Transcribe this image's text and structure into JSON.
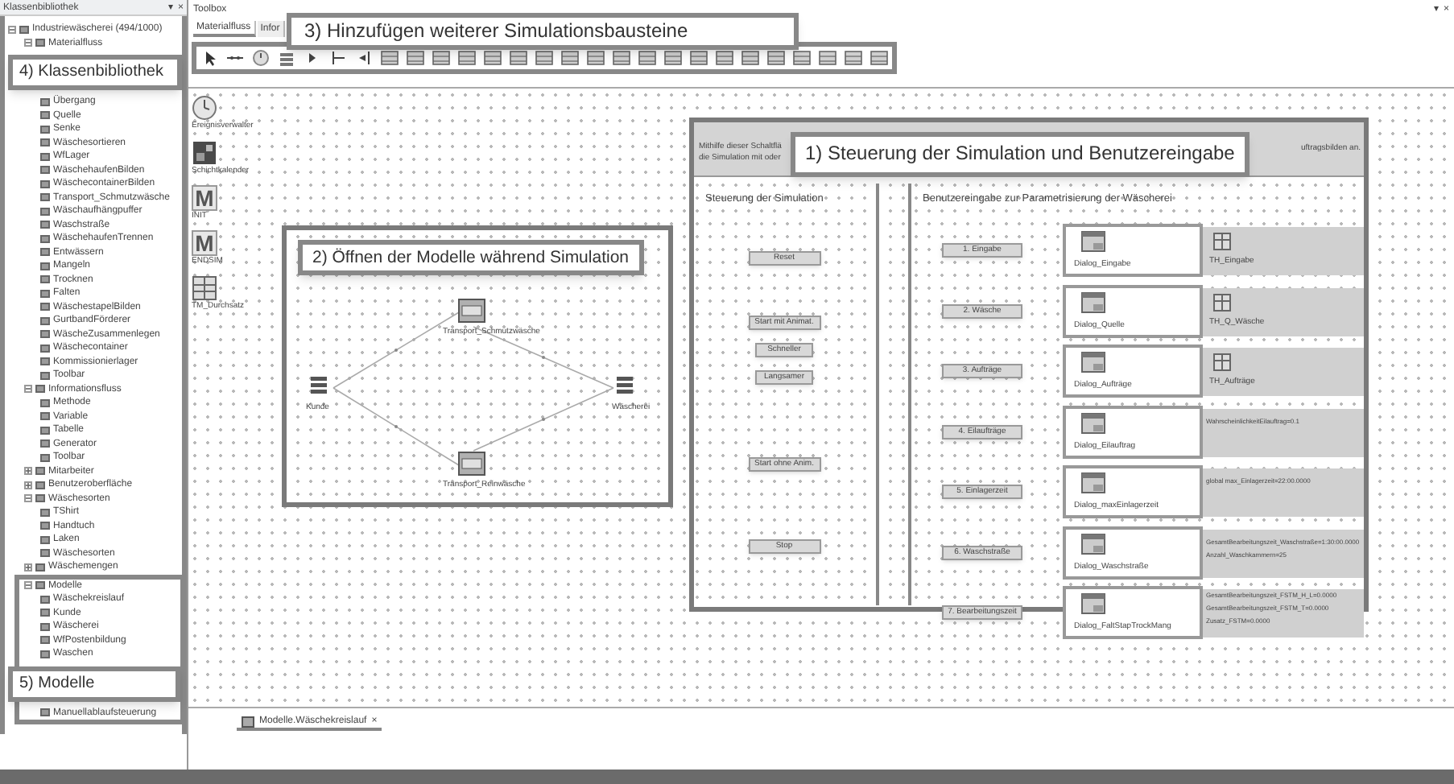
{
  "library": {
    "title": "Klassenbibliothek",
    "controls": [
      "▾",
      "×"
    ],
    "tree": [
      {
        "label": "Industriewäscherei (494/1000)",
        "expanded": true,
        "children": [
          {
            "label": "Materialfluss",
            "expanded": true,
            "children": [
              {
                "kind": "callout",
                "label": "4) Klassenbibliothek"
              },
              {
                "label": "Übergang"
              },
              {
                "label": "Quelle"
              },
              {
                "label": "Senke"
              },
              {
                "label": "Wäschesortieren"
              },
              {
                "label": "WfLager"
              },
              {
                "label": "WäschehaufenBilden"
              },
              {
                "label": "WäschecontainerBilden"
              },
              {
                "label": "Transport_Schmutzwäsche"
              },
              {
                "label": "Wäschaufhängpuffer"
              },
              {
                "label": "Waschstraße"
              },
              {
                "label": "WäschehaufenTrennen"
              },
              {
                "label": "Entwässern"
              },
              {
                "label": "Mangeln"
              },
              {
                "label": "Trocknen"
              },
              {
                "label": "Falten"
              },
              {
                "label": "WäschestapelBilden"
              },
              {
                "label": "GurtbandFörderer"
              },
              {
                "label": "WäscheZusammenlegen"
              },
              {
                "label": "Wäschecontainer"
              },
              {
                "label": "Kommissionierlager"
              },
              {
                "label": "Toolbar"
              }
            ]
          },
          {
            "label": "Informationsfluss",
            "expanded": true,
            "children": [
              {
                "label": "Methode"
              },
              {
                "label": "Variable"
              },
              {
                "label": "Tabelle"
              },
              {
                "label": "Generator"
              },
              {
                "label": "Toolbar"
              }
            ]
          },
          {
            "label": "Mitarbeiter",
            "expanded": false
          },
          {
            "label": "Benutzeroberfläche",
            "expanded": false
          },
          {
            "label": "Wäschesorten",
            "expanded": true,
            "children": [
              {
                "label": "TShirt"
              },
              {
                "label": "Handtuch"
              },
              {
                "label": "Laken"
              },
              {
                "label": "Wäschesorten"
              }
            ]
          },
          {
            "label": "Wäschemengen",
            "expanded": false
          },
          {
            "label": "Modelle",
            "expanded": true,
            "children": [
              {
                "label": "Wäschekreislauf"
              },
              {
                "label": "Kunde"
              },
              {
                "label": "Wäscherei"
              },
              {
                "label": "WfPostenbildung"
              },
              {
                "label": "Waschen"
              },
              {
                "kind": "callout",
                "label": "5) Modelle"
              },
              {
                "label": "Manuellablaufsteuerung"
              }
            ]
          }
        ]
      }
    ]
  },
  "toolbox": {
    "title": "Toolbox",
    "controls": [
      "▾",
      "×"
    ],
    "tabs": [
      {
        "label": "Materialfluss",
        "selected": true
      },
      {
        "label": "Infor",
        "selected": false
      }
    ],
    "callout": "3) Hinzufügen weiterer Simulationsbausteine"
  },
  "canvas_objects": [
    {
      "kind": "clock",
      "label": "Ereignisverwalter"
    },
    {
      "kind": "calendar",
      "label": "Schichtkalender"
    },
    {
      "kind": "method",
      "glyph": "M",
      "label": "INIT"
    },
    {
      "kind": "method",
      "glyph": "M",
      "label": "ENDSIM"
    },
    {
      "kind": "table",
      "label": "TM_Durchsatz"
    }
  ],
  "model_window": {
    "callout": "2) Öffnen der Modelle während Simulation",
    "nodes": [
      {
        "kind": "source",
        "label": "Kunde"
      },
      {
        "kind": "transport",
        "label": "Transport_Schmutzwäsche"
      },
      {
        "kind": "source",
        "label": "Wäscherei"
      },
      {
        "kind": "transport",
        "label": "Transport_Reinwäsche"
      }
    ]
  },
  "control_panel": {
    "header_lines": [
      "Mithilfe dieser Schaltflä",
      "die Simulation mit oder"
    ],
    "header_right": "uftragsbilden an.",
    "callout": "1) Steuerung der Simulation und Benutzereingabe",
    "left_title": "Steuerung der Simulation",
    "control_buttons": [
      "Reset",
      "Start mit Animat.",
      "Schneller",
      "Langsamer",
      "Start ohne Anim.",
      "Stop"
    ],
    "right_title": "Benutzereingabe zur Parametrisierung der Wäscherei",
    "rows": [
      {
        "button": "1. Eingabe",
        "dialog": "Dialog_Eingabe",
        "kind": "table",
        "values": [
          "TH_Eingabe"
        ]
      },
      {
        "button": "2. Wäsche",
        "dialog": "Dialog_Quelle",
        "kind": "table",
        "values": [
          "TH_Q_Wäsche"
        ]
      },
      {
        "button": "3. Aufträge",
        "dialog": "Dialog_Aufträge",
        "kind": "table",
        "values": [
          "TH_Aufträge"
        ]
      },
      {
        "button": "4. Eilaufträge",
        "dialog": "Dialog_Eilauftrag",
        "kind": "text",
        "values": [
          "WahrscheinlichkeitEilauftrag=0.1"
        ]
      },
      {
        "button": "5. Einlagerzeit",
        "dialog": "Dialog_maxEinlagerzeit",
        "kind": "text",
        "values": [
          "global max_Einlagerzeit=22:00.0000"
        ]
      },
      {
        "button": "6. Waschstraße",
        "dialog": "Dialog_Waschstraße",
        "kind": "text",
        "values": [
          "GesamtBearbeitungszeit_Waschstraße=1:30:00.0000",
          "Anzahl_Waschkammern=25"
        ]
      },
      {
        "button": "7. Bearbeitungszeit",
        "dialog": "Dialog_FaltStapTrockMang",
        "kind": "text",
        "values": [
          "GesamtBearbeitungszeit_FSTM_H_L=0.0000",
          "GesamtBearbeitungszeit_FSTM_T=0.0000",
          "Zusatz_FSTM=0.0000"
        ]
      }
    ]
  },
  "document_tabs": [
    {
      "label": "Modelle.Wäschekreislauf",
      "close": "×",
      "selected": true
    }
  ]
}
